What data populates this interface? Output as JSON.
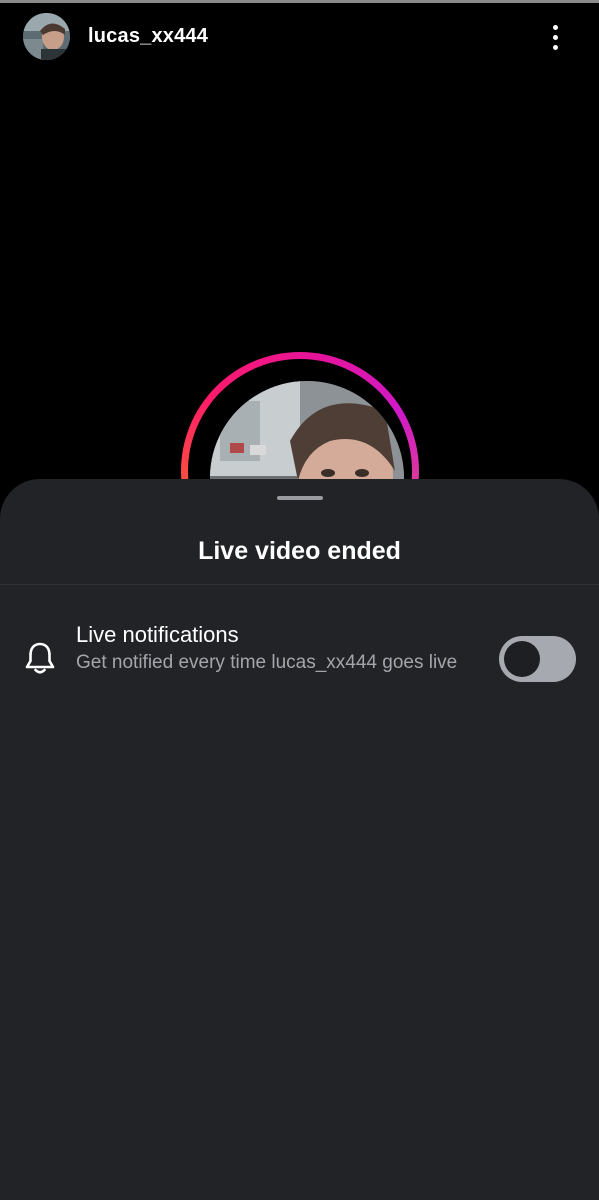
{
  "header": {
    "username": "lucas_xx444",
    "avatar_icon": "profile-photo",
    "menu_icon": "more-vertical-icon"
  },
  "live": {
    "ring_colors": [
      "#ff9a1a",
      "#ff1a6a",
      "#d01ac8"
    ]
  },
  "sheet": {
    "title": "Live video ended",
    "notification": {
      "icon": "bell-icon",
      "title": "Live notifications",
      "subtitle": "Get notified every time lucas_xx444 goes live",
      "toggle_on": false
    }
  },
  "colors": {
    "background": "#000000",
    "sheet": "#222327",
    "secondary_text": "#a4a5ab",
    "toggle_track": "#a7a9b0"
  }
}
